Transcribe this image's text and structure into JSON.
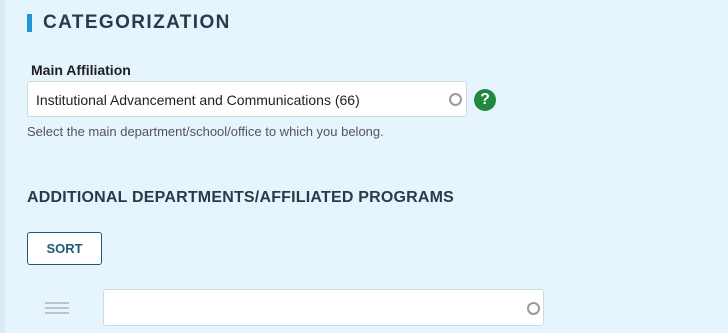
{
  "section": {
    "title": "CATEGORIZATION"
  },
  "main_affiliation": {
    "label": "Main Affiliation",
    "selected_value": "Institutional Advancement and Communications (66)",
    "help_icon_glyph": "?",
    "help_text": "Select the main department/school/office to which you belong."
  },
  "additional_departments": {
    "title": "ADDITIONAL DEPARTMENTS/AFFILIATED PROGRAMS",
    "sort_label": "SORT",
    "rows": [
      {
        "selected_value": ""
      }
    ]
  },
  "colors": {
    "accent": "#1f95d4",
    "help_green": "#1f8a3e",
    "button_text": "#1f5b78",
    "background": "#e6f4fd"
  },
  "icons": [
    "ring-icon",
    "help-icon",
    "drag-handle-icon"
  ]
}
